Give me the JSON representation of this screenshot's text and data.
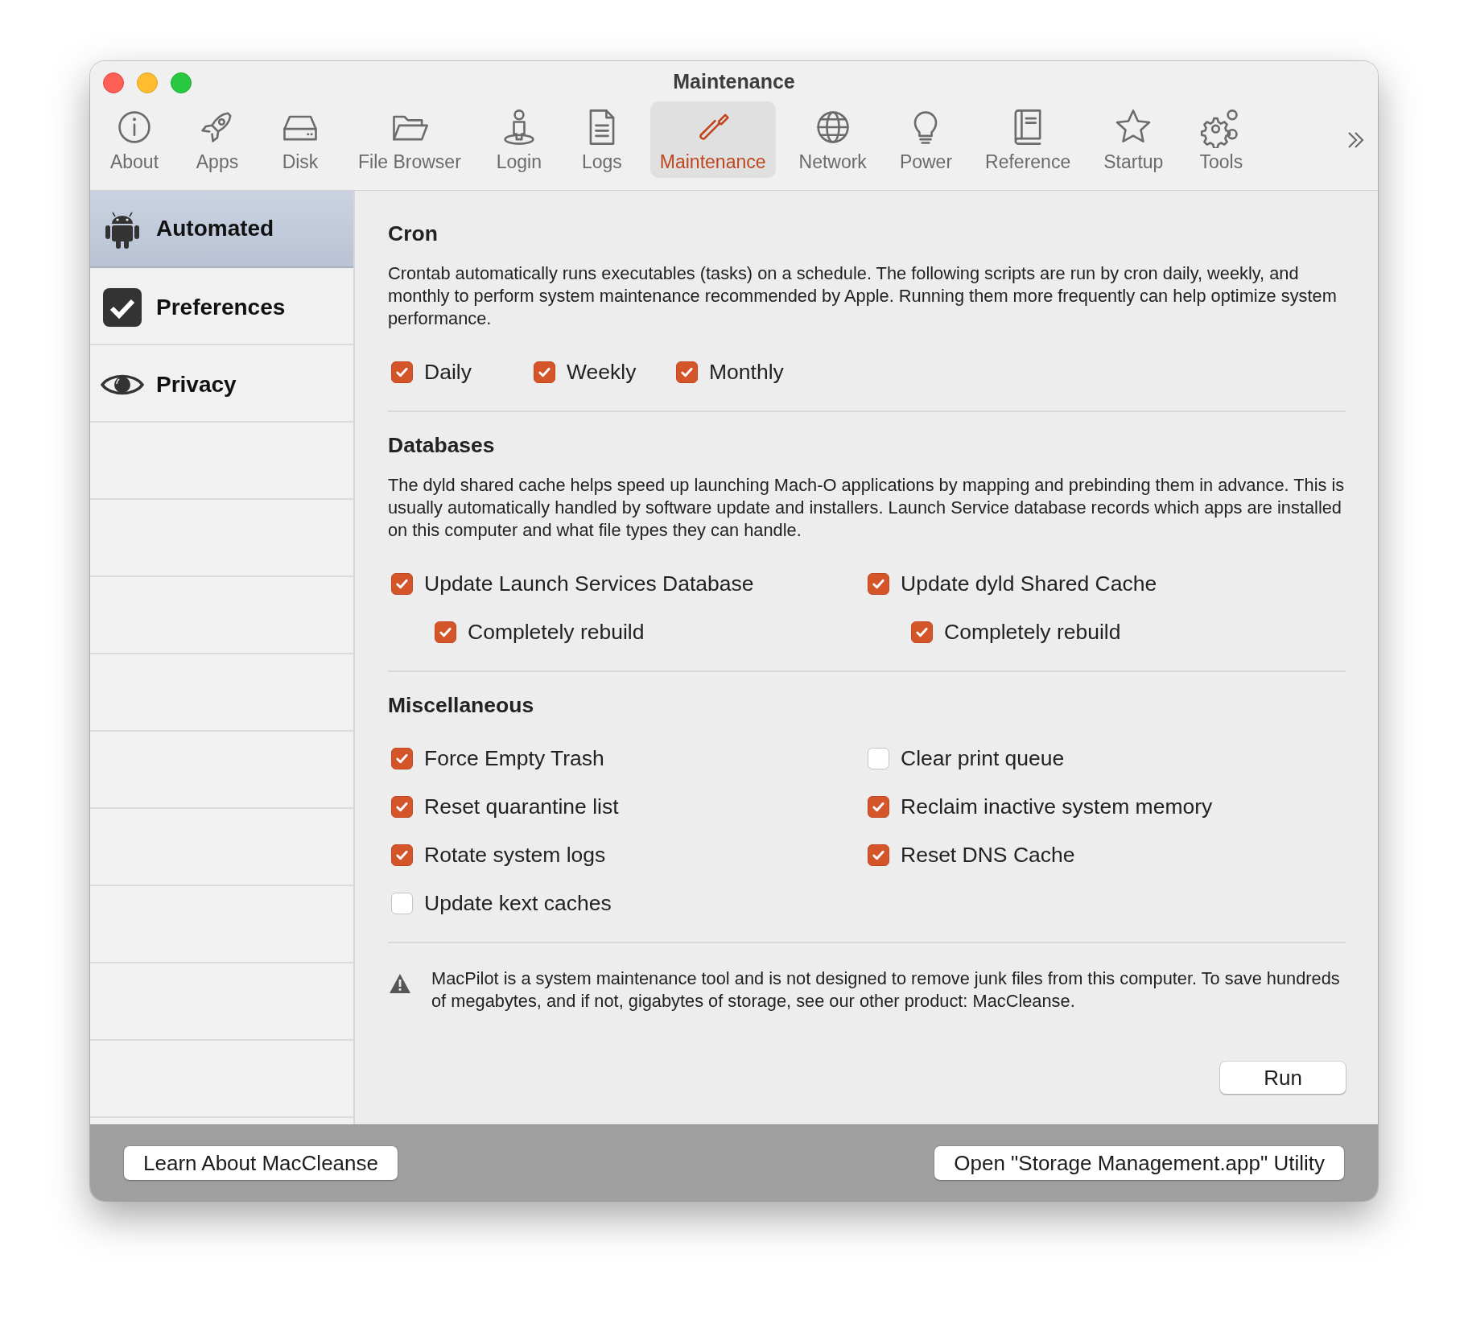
{
  "window": {
    "title": "Maintenance"
  },
  "toolbar": [
    {
      "label": "About",
      "selected": false
    },
    {
      "label": "Apps",
      "selected": false
    },
    {
      "label": "Disk",
      "selected": false
    },
    {
      "label": "File Browser",
      "selected": false
    },
    {
      "label": "Login",
      "selected": false
    },
    {
      "label": "Logs",
      "selected": false
    },
    {
      "label": "Maintenance",
      "selected": true
    },
    {
      "label": "Network",
      "selected": false
    },
    {
      "label": "Power",
      "selected": false
    },
    {
      "label": "Reference",
      "selected": false
    },
    {
      "label": "Startup",
      "selected": false
    },
    {
      "label": "Tools",
      "selected": false
    }
  ],
  "sidebar": {
    "items": [
      {
        "label": "Automated",
        "selected": true
      },
      {
        "label": "Preferences",
        "selected": false
      },
      {
        "label": "Privacy",
        "selected": false
      }
    ]
  },
  "sections": [
    {
      "title": "Cron",
      "description": "Crontab automatically runs executables (tasks) on a schedule. The following scripts are run by cron daily, weekly, and monthly to perform system maintenance recommended by Apple. Running them more frequently can help optimize system performance.",
      "options": [
        {
          "label": "Daily",
          "checked": true
        },
        {
          "label": "Weekly",
          "checked": true
        },
        {
          "label": "Monthly",
          "checked": true
        }
      ]
    },
    {
      "title": "Databases",
      "description": "The dyld shared cache helps speed up launching Mach-O applications by mapping and prebinding them in advance. This is usually automatically handled by software update and installers. Launch Service database records which apps are installed on this computer and what file types they can handle.",
      "options": [
        {
          "label": "Update Launch Services Database",
          "checked": true,
          "children": [
            {
              "label": "Completely rebuild",
              "checked": true
            }
          ]
        },
        {
          "label": "Update dyld Shared Cache",
          "checked": true,
          "children": [
            {
              "label": "Completely rebuild",
              "checked": true
            }
          ]
        }
      ]
    },
    {
      "title": "Miscellaneous",
      "options": [
        {
          "label": "Force Empty Trash",
          "checked": true
        },
        {
          "label": "Clear print queue",
          "checked": false
        },
        {
          "label": "Reset quarantine list",
          "checked": true
        },
        {
          "label": "Reclaim inactive system memory",
          "checked": true
        },
        {
          "label": "Rotate system logs",
          "checked": true
        },
        {
          "label": "Reset DNS Cache",
          "checked": true
        },
        {
          "label": "Update kext caches",
          "checked": false
        }
      ]
    }
  ],
  "notice": "MacPilot is a system maintenance tool and is not designed to remove junk files from this computer. To save hundreds of megabytes, and if not, gigabytes of storage, see our other product: MacCleanse.",
  "run_button": "Run",
  "bottom_bar": {
    "left_button": "Learn About MacCleanse",
    "right_button": "Open \"Storage Management.app\" Utility"
  }
}
